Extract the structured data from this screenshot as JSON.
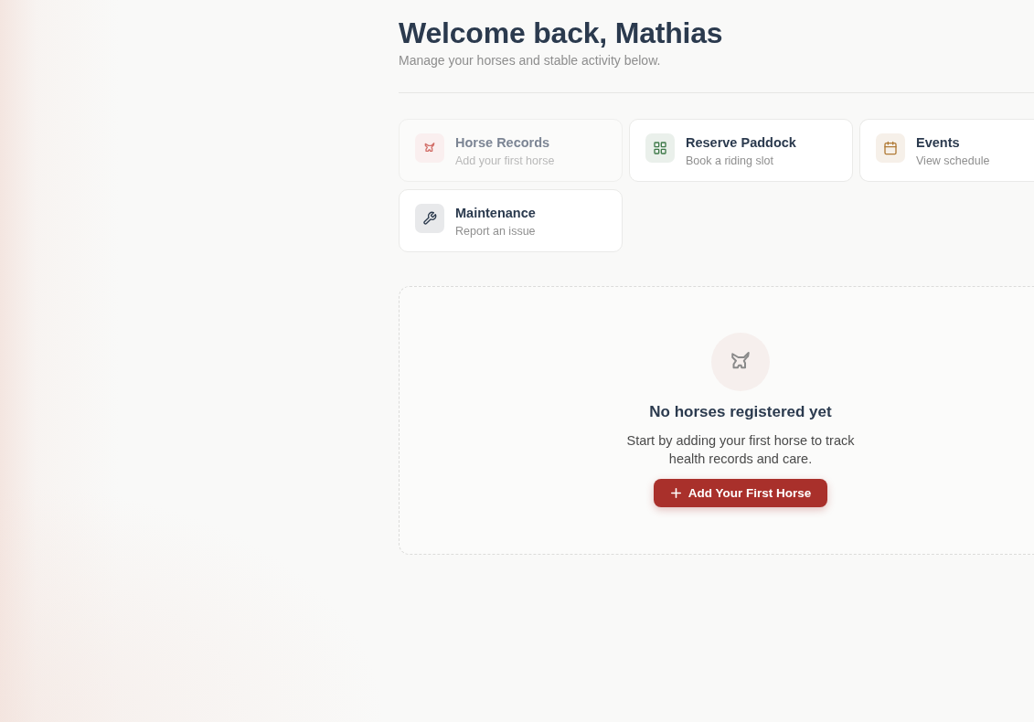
{
  "header": {
    "title": "Welcome back, Mathias",
    "subtitle": "Manage your horses and stable activity below."
  },
  "quick_actions": [
    {
      "kind": "horse",
      "title": "Horse Records",
      "subtitle": "Add your first horse",
      "disabled": true
    },
    {
      "kind": "grid",
      "title": "Reserve Paddock",
      "subtitle": "Book a riding slot",
      "disabled": false
    },
    {
      "kind": "calendar",
      "title": "Events",
      "subtitle": "View schedule",
      "disabled": false
    },
    {
      "kind": "wrench",
      "title": "Maintenance",
      "subtitle": "Report an issue",
      "disabled": false
    }
  ],
  "empty_state": {
    "kind": "horse",
    "title": "No horses registered yet",
    "message": "Start by adding your first horse to track health records and care.",
    "button": "Add Your First Horse"
  }
}
